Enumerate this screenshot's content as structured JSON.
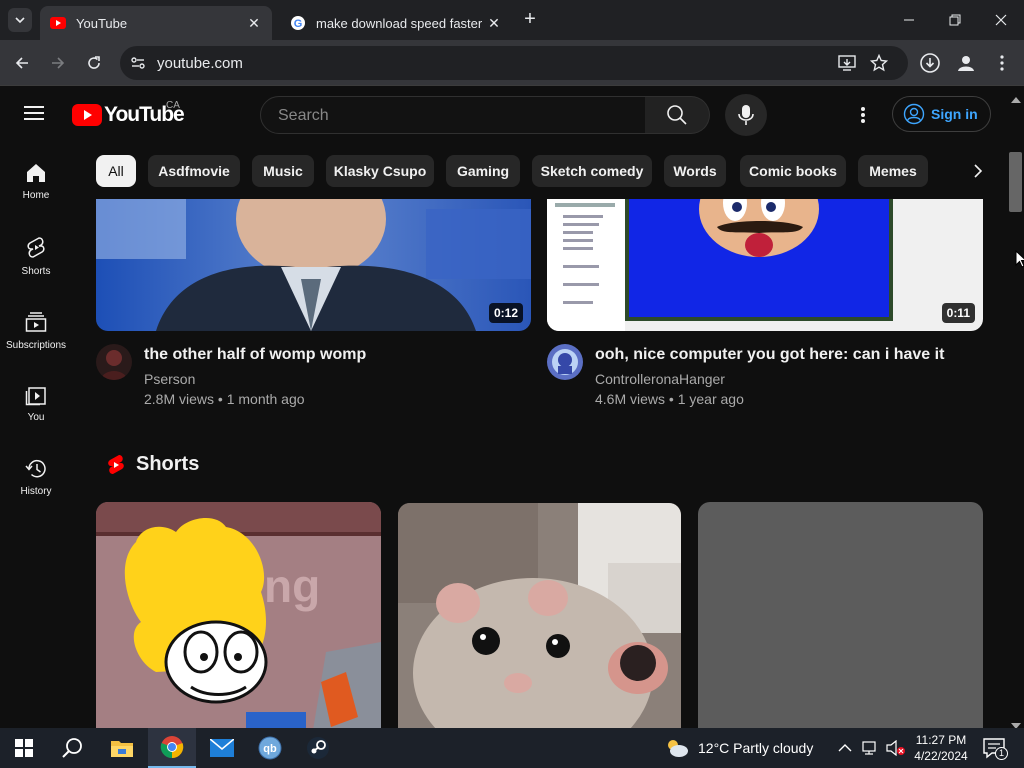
{
  "browser": {
    "tabs": [
      {
        "title": "YouTube",
        "active": true
      },
      {
        "title": "make download speed faster -",
        "active": false
      }
    ],
    "url": "youtube.com"
  },
  "masthead": {
    "logo_text": "YouTube",
    "country_code": "CA",
    "search_placeholder": "Search",
    "sign_in_label": "Sign in"
  },
  "guide": [
    {
      "label": "Home",
      "icon": "home-icon"
    },
    {
      "label": "Shorts",
      "icon": "shorts-icon"
    },
    {
      "label": "Subscriptions",
      "icon": "subscriptions-icon"
    },
    {
      "label": "You",
      "icon": "you-icon"
    },
    {
      "label": "History",
      "icon": "history-icon"
    }
  ],
  "chips": [
    "All",
    "Asdfmovie",
    "Music",
    "Klasky Csupo",
    "Gaming",
    "Sketch comedy",
    "Words",
    "Comic books",
    "Memes"
  ],
  "videos": [
    {
      "title": "the other half of womp womp",
      "channel": "Pserson",
      "meta": "2.8M views • 1 month ago",
      "duration": "0:12"
    },
    {
      "title": "ooh, nice computer you got here: can i have it",
      "channel": "ControlleronaHanger",
      "meta": "4.6M views • 1 year ago",
      "duration": "0:11"
    }
  ],
  "shorts_heading": "Shorts",
  "taskbar": {
    "weather": "12°C  Partly cloudy",
    "time": "11:27 PM",
    "date": "4/22/2024",
    "notification_count": "1"
  },
  "colors": {
    "yt_red": "#ff0000",
    "link_blue": "#3ea6ff",
    "background": "#0f0f0f"
  }
}
